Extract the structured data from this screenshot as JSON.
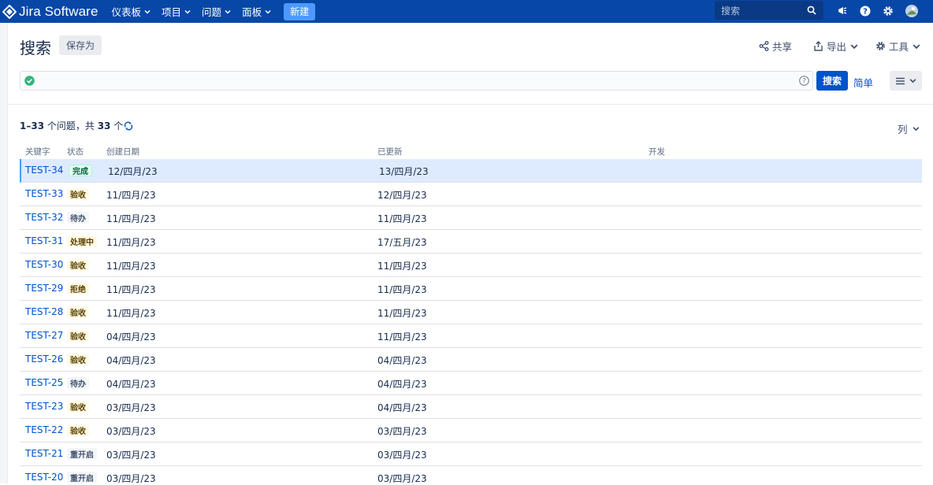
{
  "app": {
    "name": "Jira Software"
  },
  "nav": {
    "items": [
      "仪表板",
      "项目",
      "问题",
      "面板"
    ],
    "create_label": "新建",
    "search_placeholder": "搜索"
  },
  "page": {
    "title": "搜索",
    "save_as": "保存为",
    "share": "共享",
    "export": "导出",
    "tools": "工具"
  },
  "jql": {
    "value": "",
    "search_button": "搜索",
    "simple_link": "简单"
  },
  "results": {
    "range": "1–33",
    "text_mid": " 个问题，共 ",
    "total": "33",
    "text_end": " 个",
    "columns_label": "列"
  },
  "table": {
    "headers": {
      "key": "关键字",
      "status": "状态",
      "created": "创建日期",
      "updated": "已更新",
      "dev": "开发"
    },
    "rows": [
      {
        "key": "TEST-34",
        "status": "完成",
        "status_type": "done",
        "created": "12/四月/23",
        "updated": "13/四月/23"
      },
      {
        "key": "TEST-33",
        "status": "验收",
        "status_type": "acc",
        "created": "11/四月/23",
        "updated": "12/四月/23"
      },
      {
        "key": "TEST-32",
        "status": "待办",
        "status_type": "todo",
        "created": "11/四月/23",
        "updated": "11/四月/23"
      },
      {
        "key": "TEST-31",
        "status": "处理中",
        "status_type": "prog",
        "created": "11/四月/23",
        "updated": "17/五月/23"
      },
      {
        "key": "TEST-30",
        "status": "验收",
        "status_type": "acc",
        "created": "11/四月/23",
        "updated": "11/四月/23"
      },
      {
        "key": "TEST-29",
        "status": "拒绝",
        "status_type": "rej",
        "created": "11/四月/23",
        "updated": "11/四月/23"
      },
      {
        "key": "TEST-28",
        "status": "验收",
        "status_type": "acc",
        "created": "11/四月/23",
        "updated": "11/四月/23"
      },
      {
        "key": "TEST-27",
        "status": "验收",
        "status_type": "acc",
        "created": "04/四月/23",
        "updated": "11/四月/23"
      },
      {
        "key": "TEST-26",
        "status": "验收",
        "status_type": "acc",
        "created": "04/四月/23",
        "updated": "04/四月/23"
      },
      {
        "key": "TEST-25",
        "status": "待办",
        "status_type": "todo",
        "created": "04/四月/23",
        "updated": "04/四月/23"
      },
      {
        "key": "TEST-23",
        "status": "验收",
        "status_type": "acc",
        "created": "03/四月/23",
        "updated": "04/四月/23"
      },
      {
        "key": "TEST-22",
        "status": "验收",
        "status_type": "acc",
        "created": "03/四月/23",
        "updated": "03/四月/23"
      },
      {
        "key": "TEST-21",
        "status": "重开启",
        "status_type": "reopen",
        "created": "03/四月/23",
        "updated": "03/四月/23"
      },
      {
        "key": "TEST-20",
        "status": "重开启",
        "status_type": "reopen",
        "created": "03/四月/23",
        "updated": "03/四月/23"
      }
    ]
  },
  "colors": {
    "nav_bg": "#0747a6",
    "primary": "#0052cc",
    "selected_row": "#deebff"
  },
  "icons": [
    "jira-logo-icon",
    "chevron-down-icon",
    "search-icon",
    "notifications-icon",
    "help-icon",
    "gear-icon",
    "avatar",
    "check-circle-icon",
    "question-circle-icon",
    "share-icon",
    "export-icon",
    "list-view-icon",
    "refresh-icon"
  ]
}
